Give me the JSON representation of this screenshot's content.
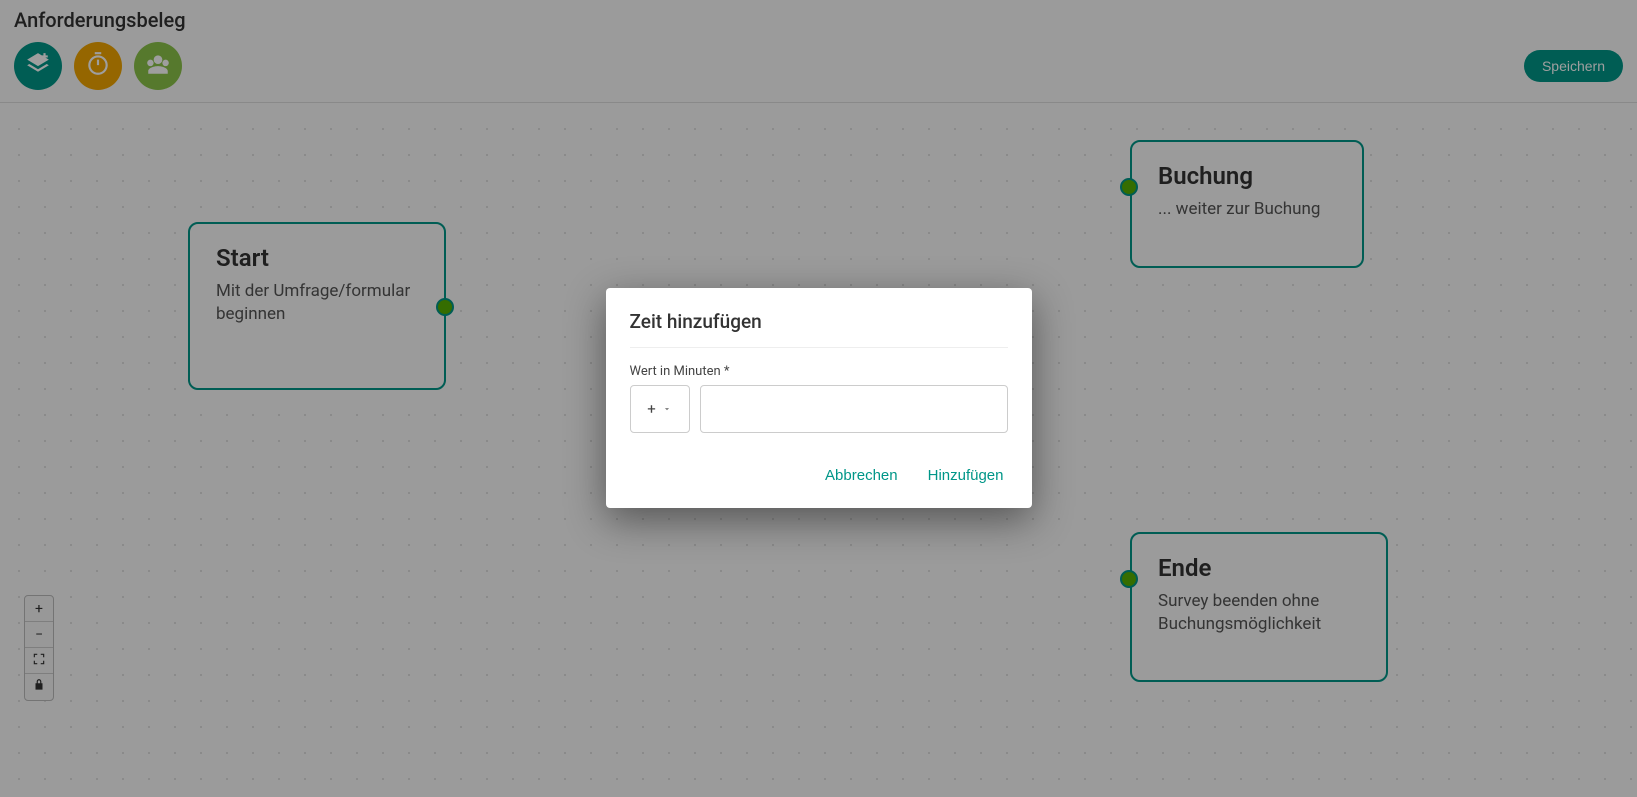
{
  "header": {
    "page_title": "Anforderungsbeleg",
    "save_label": "Speichern"
  },
  "nodes": {
    "start": {
      "title": "Start",
      "subtitle": "Mit der Umfrage/formular beginnen"
    },
    "booking": {
      "title": "Buchung",
      "subtitle": "... weiter zur Buchung"
    },
    "end": {
      "title": "Ende",
      "subtitle": "Survey beenden ohne Buchungsmöglichkeit"
    }
  },
  "modal": {
    "title": "Zeit hinzufügen",
    "field_label": "Wert in Minuten *",
    "operator_value": "+",
    "minutes_value": "",
    "cancel_label": "Abbrechen",
    "confirm_label": "Hinzufügen"
  },
  "icons": {
    "layers": "layers-plus-icon",
    "timer": "timer-icon",
    "group": "group-icon"
  },
  "colors": {
    "teal": "#009688",
    "amber": "#f0a500",
    "olive": "#8bc34a",
    "connector": "#56b000"
  }
}
